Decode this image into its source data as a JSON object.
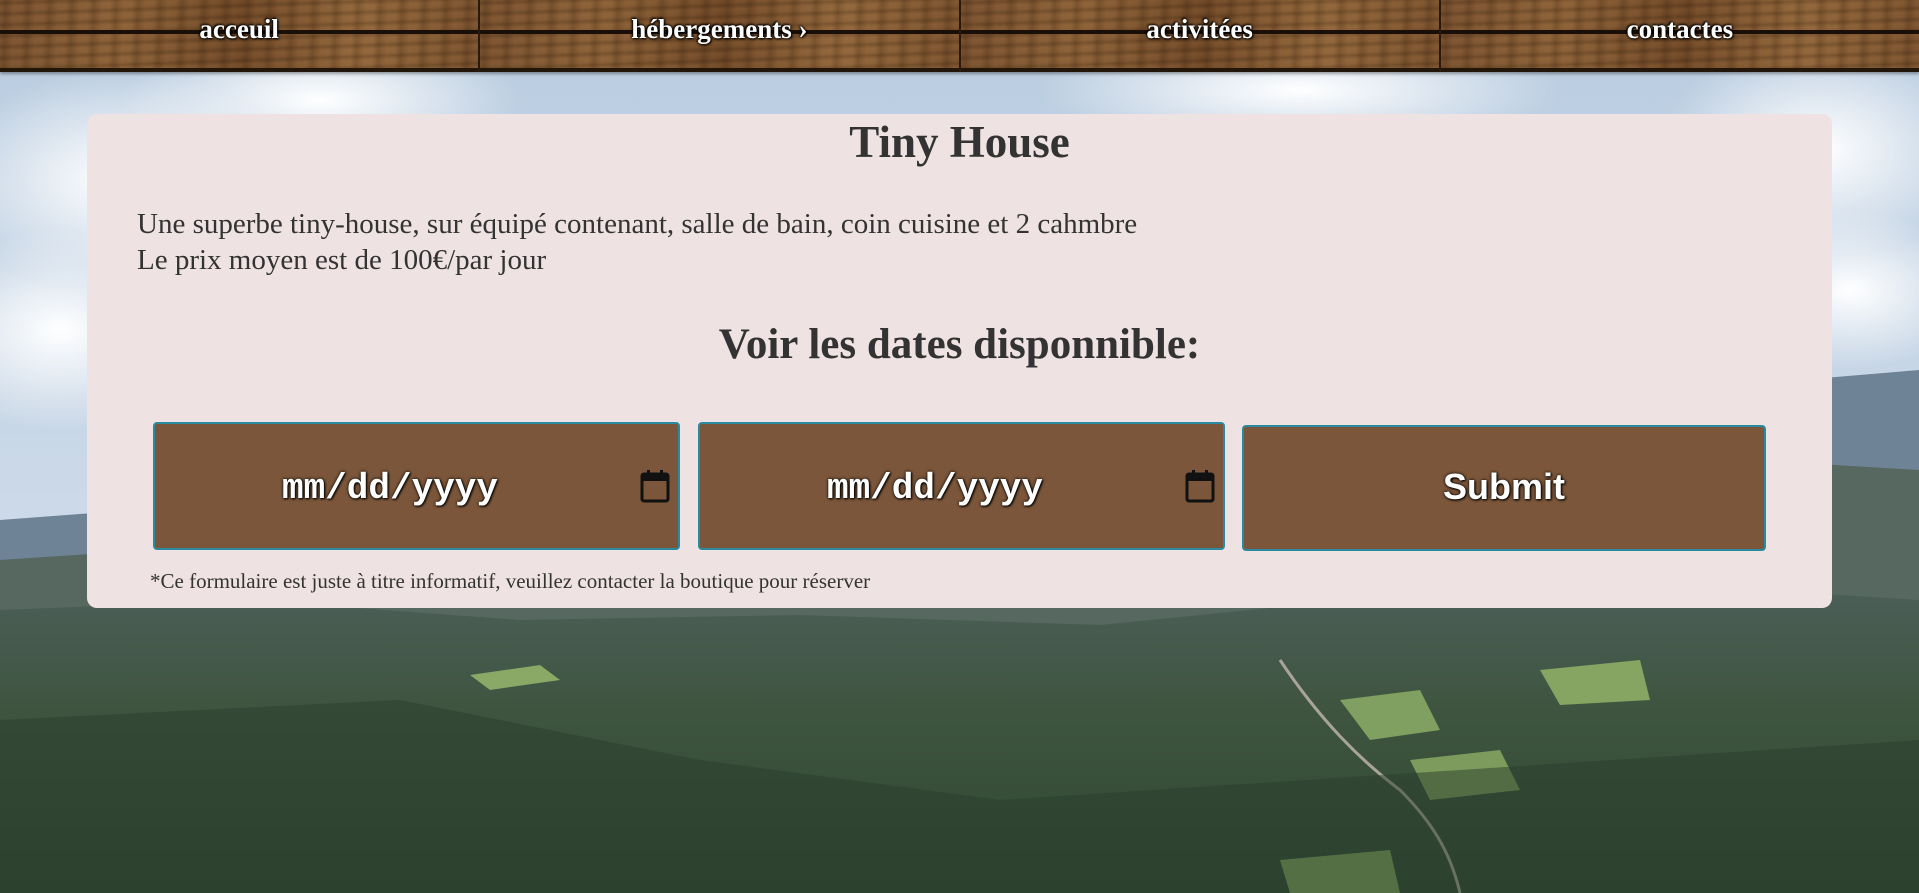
{
  "nav": {
    "items": [
      {
        "label": "acceuil"
      },
      {
        "label": "hébergements ›"
      },
      {
        "label": "activitées"
      },
      {
        "label": "contactes"
      }
    ]
  },
  "card": {
    "title": "Tiny House",
    "description_line1": "Une superbe tiny-house, sur équipé contenant, salle de bain, coin cuisine et 2 cahmbre",
    "description_line2": "Le prix moyen est de 100€/par jour",
    "dates_title": "Voir les dates disponnible:",
    "start_date": {
      "value": "mm/dd/yyyy",
      "icon": "calendar-icon"
    },
    "end_date": {
      "value": "mm/dd/yyyy",
      "icon": "calendar-icon"
    },
    "submit_label": "Submit",
    "footnote": "*Ce formulaire est juste à titre informatif, veuillez contacter la boutique pour réserver"
  },
  "colors": {
    "card_bg": "#efe2e2",
    "button_bg": "#7b563a",
    "button_border": "#2a8aa0",
    "text": "#333333"
  }
}
